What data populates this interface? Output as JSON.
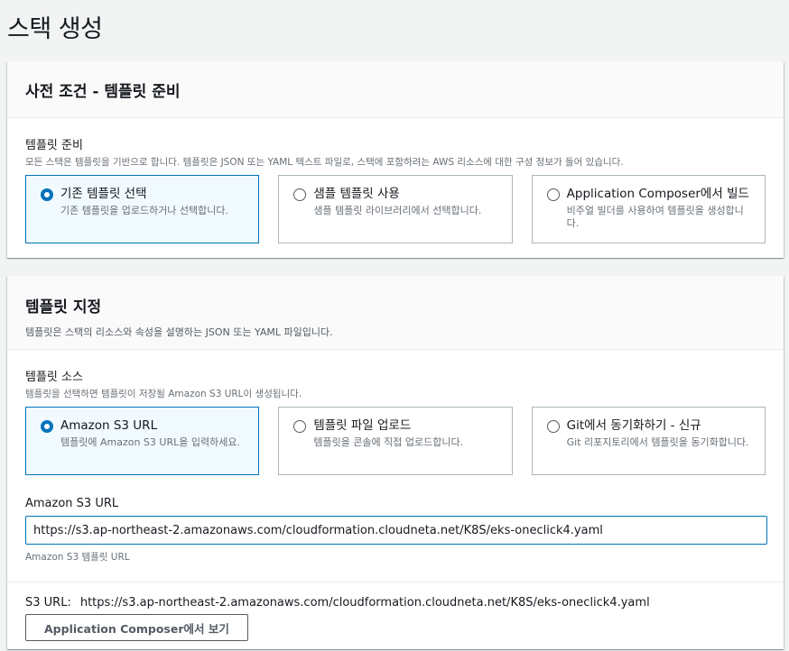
{
  "page": {
    "title": "스택 생성"
  },
  "prerequisite": {
    "title": "사전 조건 - 템플릿 준비",
    "field_label": "템플릿 준비",
    "field_desc": "모든 스택은 템플릿을 기반으로 합니다. 템플릿은 JSON 또는 YAML 텍스트 파일로, 스택에 포함하려는 AWS 리소스에 대한 구성 정보가 들어 있습니다.",
    "options": [
      {
        "title": "기존 템플릿 선택",
        "desc": "기존 템플릿을 업로드하거나 선택합니다.",
        "selected": true
      },
      {
        "title": "샘플 템플릿 사용",
        "desc": "샘플 템플릿 라이브러리에서 선택합니다.",
        "selected": false
      },
      {
        "title": "Application Composer에서 빌드",
        "desc": "비주얼 빌더를 사용하여 템플릿을 생성합니다.",
        "selected": false
      }
    ]
  },
  "specify": {
    "title": "템플릿 지정",
    "desc": "템플릿은 스택의 리소스와 속성을 설명하는 JSON 또는 YAML 파일입니다.",
    "source_label": "템플릿 소스",
    "source_desc": "템플릿을 선택하면 템플릿이 저장될 Amazon S3 URL이 생성됩니다.",
    "options": [
      {
        "title": "Amazon S3 URL",
        "desc": "템플릿에 Amazon S3 URL을 입력하세요.",
        "selected": true
      },
      {
        "title": "템플릿 파일 업로드",
        "desc": "템플릿을 콘솔에 직접 업로드합니다.",
        "selected": false
      },
      {
        "title": "Git에서 동기화하기 - 신규",
        "desc": "Git 리포지토리에서 템플릿을 동기화합니다.",
        "selected": false
      }
    ],
    "url_label": "Amazon S3 URL",
    "url_value": "https://s3.ap-northeast-2.amazonaws.com/cloudformation.cloudneta.net/K8S/eks-oneclick4.yaml",
    "url_hint": "Amazon S3 템플릿 URL",
    "s3_url_label": "S3 URL:",
    "s3_url_value": "https://s3.ap-northeast-2.amazonaws.com/cloudformation.cloudneta.net/K8S/eks-oneclick4.yaml",
    "view_button": "Application Composer에서 보기"
  },
  "colors": {
    "accent": "#0073bb",
    "selected_bg": "#f1faff",
    "page_bg": "#f2f3f3"
  }
}
